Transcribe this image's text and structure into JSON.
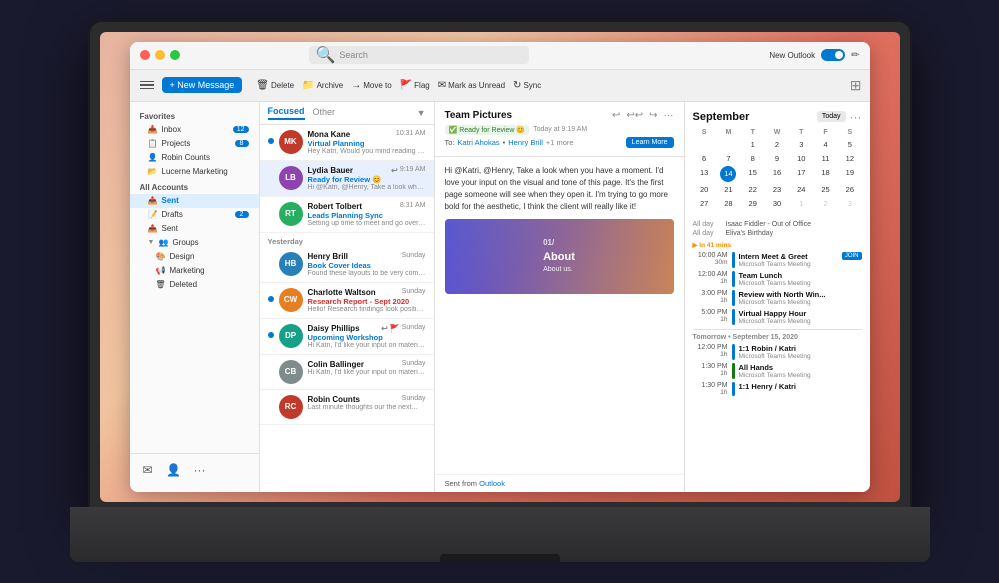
{
  "titlebar": {
    "search_placeholder": "Search",
    "new_outlook_label": "New Outlook",
    "window_controls": [
      "close",
      "minimize",
      "maximize"
    ]
  },
  "toolbar": {
    "new_message_label": "+ New Message",
    "actions": [
      {
        "icon": "🗑",
        "label": "Delete"
      },
      {
        "icon": "📁",
        "label": "Archive"
      },
      {
        "icon": "→",
        "label": "Move to"
      },
      {
        "icon": "🚩",
        "label": "Flag"
      },
      {
        "icon": "✉",
        "label": "Mark as Unread"
      },
      {
        "icon": "↻",
        "label": "Sync"
      }
    ]
  },
  "sidebar": {
    "favorites_label": "Favorites",
    "favorites_items": [
      {
        "label": "Inbox",
        "badge": "12"
      },
      {
        "label": "Projects",
        "badge": "8"
      },
      {
        "label": "Robin Counts",
        "badge": ""
      },
      {
        "label": "Lucerne Marketing",
        "badge": ""
      }
    ],
    "all_accounts_label": "All Accounts",
    "accounts_items": [
      {
        "label": "Sent",
        "active": true
      },
      {
        "label": "Drafts",
        "badge": "2"
      },
      {
        "label": "Sent"
      },
      {
        "label": "Groups"
      }
    ],
    "groups_items": [
      {
        "label": "Design"
      },
      {
        "label": "Marketing"
      },
      {
        "label": "Deleted"
      }
    ],
    "bottom_icons": [
      "✉",
      "👤",
      "···"
    ]
  },
  "message_list": {
    "tabs": [
      {
        "label": "Focused",
        "active": true
      },
      {
        "label": "Other"
      }
    ],
    "messages": [
      {
        "sender": "Mona Kane",
        "time": "10:31 AM",
        "subject": "Virtual Planning",
        "preview": "Hey Katri, Would you mind reading the draft...",
        "avatar_color": "#c0392b",
        "avatar_initials": "MK",
        "unread": true
      },
      {
        "sender": "Lydia Bauer",
        "time": "9:19 AM",
        "subject": "Ready for Review 😊",
        "preview": "Hi @Katri, @Henry, Take a look when you have...",
        "avatar_color": "#8e44ad",
        "avatar_initials": "LB",
        "unread": false,
        "selected": true
      },
      {
        "sender": "Robert Tolbert",
        "time": "8:31 AM",
        "subject": "Leads Planning Sync",
        "preview": "Setting up time to meet and go over planning...",
        "avatar_color": "#27ae60",
        "avatar_initials": "RT",
        "unread": false
      }
    ],
    "yesterday_messages": [
      {
        "sender": "Henry Brill",
        "time": "Sunday",
        "subject": "Book Cover Ideas",
        "preview": "Found these layouts to be very compelling...",
        "avatar_color": "#2980b9",
        "avatar_initials": "HB",
        "unread": false
      },
      {
        "sender": "Charlotte Waltson",
        "time": "Sunday",
        "subject": "Research Report - Sept 2020",
        "preview": "Hello! Research findings look positive for...",
        "avatar_color": "#e67e22",
        "avatar_initials": "CW",
        "unread": true
      },
      {
        "sender": "Daisy Phillips",
        "time": "Sunday",
        "subject": "Upcoming Workshop",
        "preview": "Hi Katri, I'd like your input on material...",
        "avatar_color": "#16a085",
        "avatar_initials": "DP",
        "unread": true
      },
      {
        "sender": "Colin Ballinger",
        "time": "Sunday",
        "subject": "",
        "preview": "Hi Katri, I'd like your input on material...",
        "avatar_color": "#7f8c8d",
        "avatar_initials": "CB",
        "unread": false
      },
      {
        "sender": "Robin Counts",
        "time": "Sunday",
        "subject": "",
        "preview": "Last minute thoughts our the next...",
        "avatar_color": "#c0392b",
        "avatar_initials": "RC",
        "unread": false
      }
    ],
    "yesterday_label": "Yesterday"
  },
  "email": {
    "title": "Team Pictures",
    "status": "Ready for Review 😊",
    "timestamp": "Today at 9:19 AM",
    "to_label": "To:",
    "to": "Katri Ahokas",
    "cc": "Henry Brill",
    "cc_more": "+1 more",
    "learn_more_label": "Learn More",
    "body_paragraph1": "Hi @Katri, @Henry, Take a look when you have a moment. I'd love your input on the visual and tone of this page. It's the first page someone will see when they open it. I'm trying to go more bold for the aesthetic, I think the client will really like it!",
    "image_label": "About",
    "image_sublabel": "About us.",
    "footer_label": "Sent from",
    "footer_link": "Outlook"
  },
  "calendar": {
    "month": "September",
    "today_btn": "Today",
    "day_headers": [
      "S",
      "M",
      "T",
      "W",
      "T",
      "F",
      "S"
    ],
    "weeks": [
      [
        "",
        "",
        "1",
        "2",
        "3",
        "4",
        "5"
      ],
      [
        "6",
        "7",
        "8",
        "9",
        "10",
        "11",
        "12"
      ],
      [
        "13",
        "14",
        "15",
        "16",
        "17",
        "18",
        "19"
      ],
      [
        "20",
        "21",
        "22",
        "23",
        "24",
        "25",
        "26"
      ],
      [
        "27",
        "28",
        "29",
        "30",
        "1",
        "2",
        "3"
      ]
    ],
    "today": "14",
    "all_day_events": [
      {
        "label": "All day",
        "title": "Isaac Fiddler - Out of Office"
      },
      {
        "label": "All day",
        "title": "Eliva's Birthday"
      }
    ],
    "events": [
      {
        "time": "10:00 AM",
        "duration": "30m",
        "title": "Intern Meet & Greet",
        "subtitle": "Microsoft Teams Meeting",
        "color": "#0078d4",
        "badge": "JOIN",
        "highlight": true,
        "in_minutes": "In 41 mins"
      },
      {
        "time": "12:00 AM",
        "duration": "1h",
        "title": "Team Lunch",
        "subtitle": "Microsoft Teams Meeting",
        "color": "#0078d4"
      },
      {
        "time": "3:00 PM",
        "duration": "1h",
        "title": "Review with North Win...",
        "subtitle": "Microsoft Teams Meeting",
        "color": "#0078d4"
      },
      {
        "time": "5:00 PM",
        "duration": "1h",
        "title": "Virtual Happy Hour",
        "subtitle": "Microsoft Teams Meeting",
        "color": "#0078d4"
      }
    ],
    "tomorrow_label": "Tomorrow • September 15, 2020",
    "tomorrow_events": [
      {
        "time": "12:00 PM",
        "duration": "1h",
        "title": "1:1 Robin / Katri",
        "subtitle": "Microsoft Teams Meeting",
        "color": "#0078d4"
      },
      {
        "time": "1:30 PM",
        "duration": "1h",
        "title": "All Hands",
        "subtitle": "Microsoft Teams Meeting",
        "color": "#107c10"
      },
      {
        "time": "1:30 PM",
        "duration": "1h",
        "title": "1:1 Henry / Katri",
        "subtitle": "",
        "color": "#0078d4"
      }
    ]
  }
}
